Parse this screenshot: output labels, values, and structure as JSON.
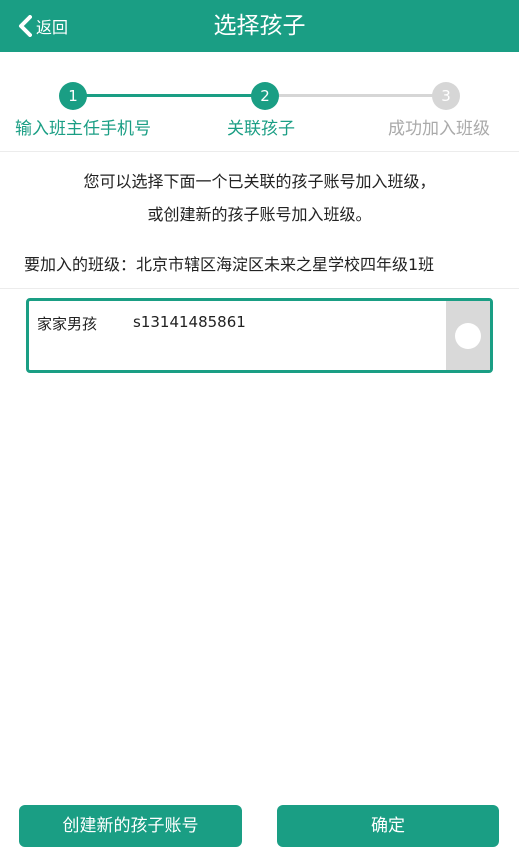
{
  "header": {
    "back_label": "返回",
    "title": "选择孩子",
    "color": "#1a9e84"
  },
  "steps": [
    {
      "number": "1",
      "label": "输入班主任手机号",
      "state": "done"
    },
    {
      "number": "2",
      "label": "关联孩子",
      "state": "active"
    },
    {
      "number": "3",
      "label": "成功加入班级",
      "state": "pending"
    }
  ],
  "intro": {
    "line1": "您可以选择下面一个已关联的孩子账号加入班级，",
    "line2": "或创建新的孩子账号加入班级。"
  },
  "class_info": "要加入的班级：北京市辖区海淀区未来之星学校四年级1班",
  "children": [
    {
      "name": "家家男孩",
      "account": "s13141485861",
      "selected": false
    }
  ],
  "buttons": {
    "create_label": "创建新的孩子账号",
    "confirm_label": "确定"
  }
}
